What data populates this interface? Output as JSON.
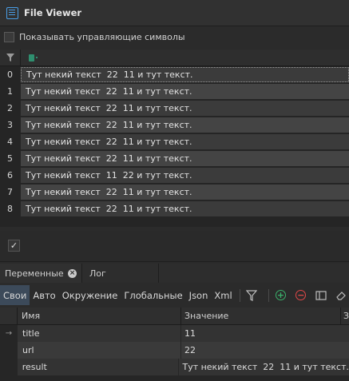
{
  "window": {
    "title": "File Viewer"
  },
  "options": {
    "show_control_chars_label": "Показывать управляющие символы",
    "show_control_chars": false
  },
  "grid": {
    "column_tag": "",
    "rows": [
      {
        "index": "0",
        "text": "Тут некий текст  22  11 и тут текст."
      },
      {
        "index": "1",
        "text": "Тут некий текст  22  11 и тут текст."
      },
      {
        "index": "2",
        "text": "Тут некий текст  22  11 и тут текст."
      },
      {
        "index": "3",
        "text": "Тут некий текст  22  11 и тут текст."
      },
      {
        "index": "4",
        "text": "Тут некий текст  22  11 и тут текст."
      },
      {
        "index": "5",
        "text": "Тут некий текст  22  11 и тут текст."
      },
      {
        "index": "6",
        "text": "Тут некий текст  11  22 и тут текст."
      },
      {
        "index": "7",
        "text": "Тут некий текст  22  11 и тут текст."
      },
      {
        "index": "8",
        "text": "Тут некий текст  22  11 и тут текст."
      }
    ]
  },
  "confirm": {
    "checked": true,
    "glyph": "✓"
  },
  "tabs": {
    "variables": "Переменные",
    "log": "Лог"
  },
  "toolbar": {
    "own": "Свои",
    "auto": "Авто",
    "env": "Окружение",
    "global": "Глобальные",
    "json": "Json",
    "xml": "Xml"
  },
  "vars": {
    "col_name": "Имя",
    "col_value": "Значение",
    "col_more": "З",
    "rows": [
      {
        "marker": "→",
        "name": "title",
        "value": "11"
      },
      {
        "marker": "",
        "name": "url",
        "value": "22"
      },
      {
        "marker": "",
        "name": "result",
        "value": "Тут некий текст  22  11 и тут текст."
      }
    ]
  }
}
